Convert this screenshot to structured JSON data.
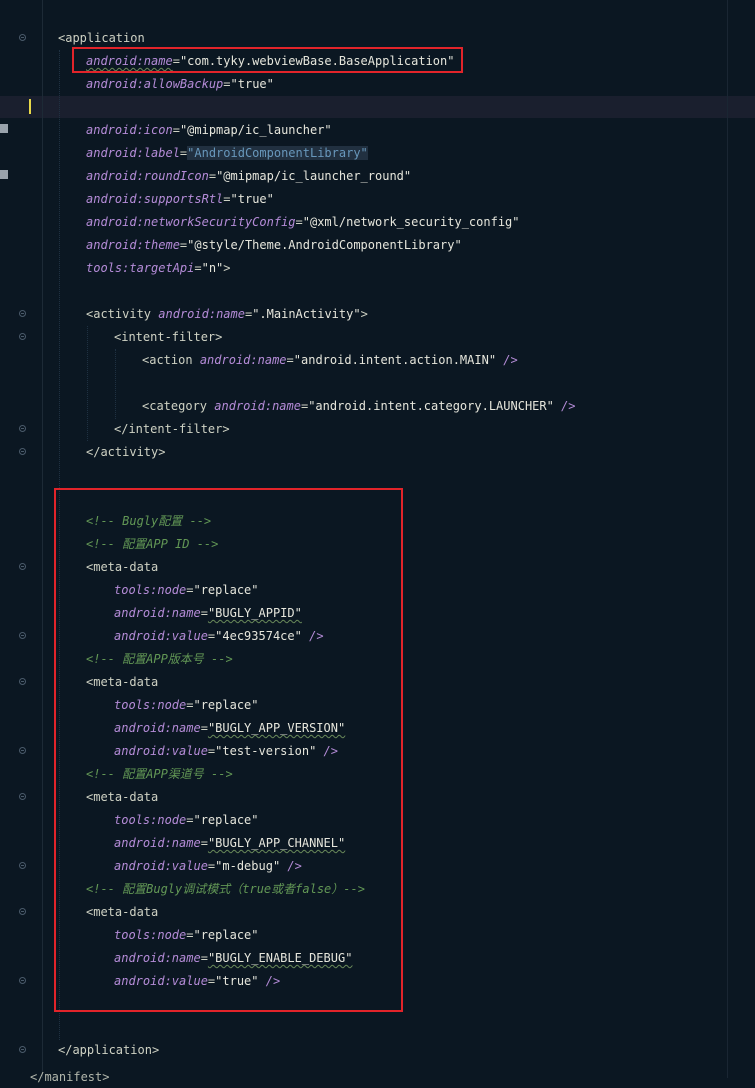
{
  "colors": {
    "background": "#0b1722",
    "highlight_box": "#e2242a",
    "attribute": "#b58cd8",
    "comment": "#629755",
    "caret": "#e8d94a"
  },
  "lines": {
    "app_open": "application",
    "app_name_attr": "android:name",
    "app_name_val": "\"com.tyky.webviewBase.BaseApplication\"",
    "allow_backup_attr": "android:allowBackup",
    "allow_backup_val": "\"true\"",
    "icon_attr": "android:icon",
    "icon_val": "\"@mipmap/ic_launcher\"",
    "label_attr": "android:label",
    "label_val": "\"AndroidComponentLibrary\"",
    "round_icon_attr": "android:roundIcon",
    "round_icon_val": "\"@mipmap/ic_launcher_round\"",
    "rtl_attr": "android:supportsRtl",
    "rtl_val": "\"true\"",
    "nsc_attr": "android:networkSecurityConfig",
    "nsc_val": "\"@xml/network_security_config\"",
    "theme_attr": "android:theme",
    "theme_val": "\"@style/Theme.AndroidComponentLibrary\"",
    "target_api_attr": "tools:targetApi",
    "target_api_val": "\"n\"",
    "activity_tag": "activity",
    "activity_attr": "android:name",
    "activity_val": "\".MainActivity\"",
    "intent_filter_open": "intent-filter",
    "action_tag": "action",
    "action_attr": "android:name",
    "action_val": "\"android.intent.action.MAIN\"",
    "category_tag": "category",
    "category_attr": "android:name",
    "category_val": "\"android.intent.category.LAUNCHER\"",
    "intent_filter_close": "intent-filter",
    "activity_close": "activity",
    "comment_bugly": "<!-- Bugly配置 -->",
    "comment_app_id": "<!-- 配置APP ID -->",
    "meta_data": "meta-data",
    "node_attr": "tools:node",
    "node_val": "\"replace\"",
    "name_attr": "android:name",
    "value_attr": "android:value",
    "appid_name": "\"BUGLY_APPID\"",
    "appid_value": "\"4ec93574ce\"",
    "comment_version": "<!-- 配置APP版本号 -->",
    "version_name": "\"BUGLY_APP_VERSION\"",
    "version_value": "\"test-version\"",
    "comment_channel": "<!-- 配置APP渠道号 -->",
    "channel_name": "\"BUGLY_APP_CHANNEL\"",
    "channel_value": "\"m-debug\"",
    "comment_debug": "<!-- 配置Bugly调试模式（true或者false）-->",
    "debug_name": "\"BUGLY_ENABLE_DEBUG\"",
    "debug_value": "\"true\"",
    "app_close": "application",
    "partial_last": "</manifest>"
  }
}
